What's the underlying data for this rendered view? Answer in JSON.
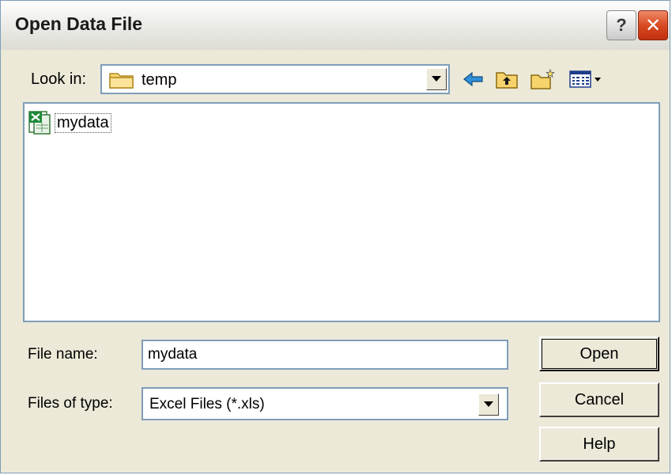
{
  "dialog": {
    "title": "Open Data File",
    "help_button": "?",
    "close_button": "✕"
  },
  "look_in": {
    "label": "Look in:",
    "value": "temp"
  },
  "files": [
    {
      "name": "mydata",
      "icon": "excel-file-icon"
    }
  ],
  "file_name": {
    "label": "File name:",
    "value": "mydata"
  },
  "file_type": {
    "label": "Files of type:",
    "value": "Excel Files (*.xls)"
  },
  "buttons": {
    "open": "Open",
    "cancel": "Cancel",
    "help": "Help"
  },
  "colors": {
    "dialog_bg": "#ece9d8",
    "field_border": "#7f9db9",
    "close_red": "#d94a22"
  }
}
